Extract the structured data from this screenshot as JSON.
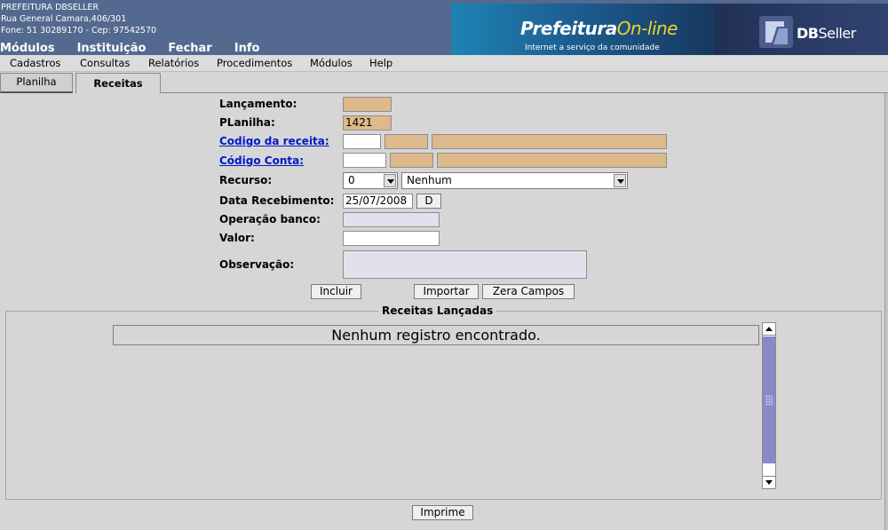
{
  "header": {
    "org_name": "PREFEITURA DBSELLER",
    "address": "Rua General Camara,406/301",
    "contact": "Fone: 51 30289170  -  Cep: 97542570",
    "nav": [
      "Módulos",
      "Instituição",
      "Fechar",
      "Info"
    ],
    "banner_prefeitura": "Prefeitura",
    "banner_online": "On-line",
    "banner_tagline": "Internet a serviço da comunidade",
    "banner_db": "DB",
    "banner_seller": "Seller"
  },
  "menubar": [
    "Cadastros",
    "Consultas",
    "Relatórios",
    "Procedimentos",
    "Módulos",
    "Help"
  ],
  "tabs": [
    "Planilha",
    "Receitas"
  ],
  "form": {
    "lancamento_label": "Lançamento:",
    "lancamento_value": "",
    "planilha_label": "PLanilha:",
    "planilha_value": "1421",
    "codigo_receita_label": "Codigo da receita:",
    "codigo_conta_label": "Código Conta:",
    "recurso_label": "Recurso:",
    "recurso_code": "0",
    "recurso_desc": "Nenhum",
    "data_label": "Data Recebimento:",
    "data_value": "25/07/2008",
    "data_button": "D",
    "operacao_label": "Operação banco:",
    "valor_label": "Valor:",
    "observacao_label": "Observação:"
  },
  "buttons": {
    "incluir": "Incluir",
    "importar": "Importar",
    "zera": "Zera Campos",
    "imprime": "Imprime"
  },
  "receitas": {
    "legend": "Receitas Lançadas",
    "empty_message": "Nenhum registro encontrado."
  }
}
